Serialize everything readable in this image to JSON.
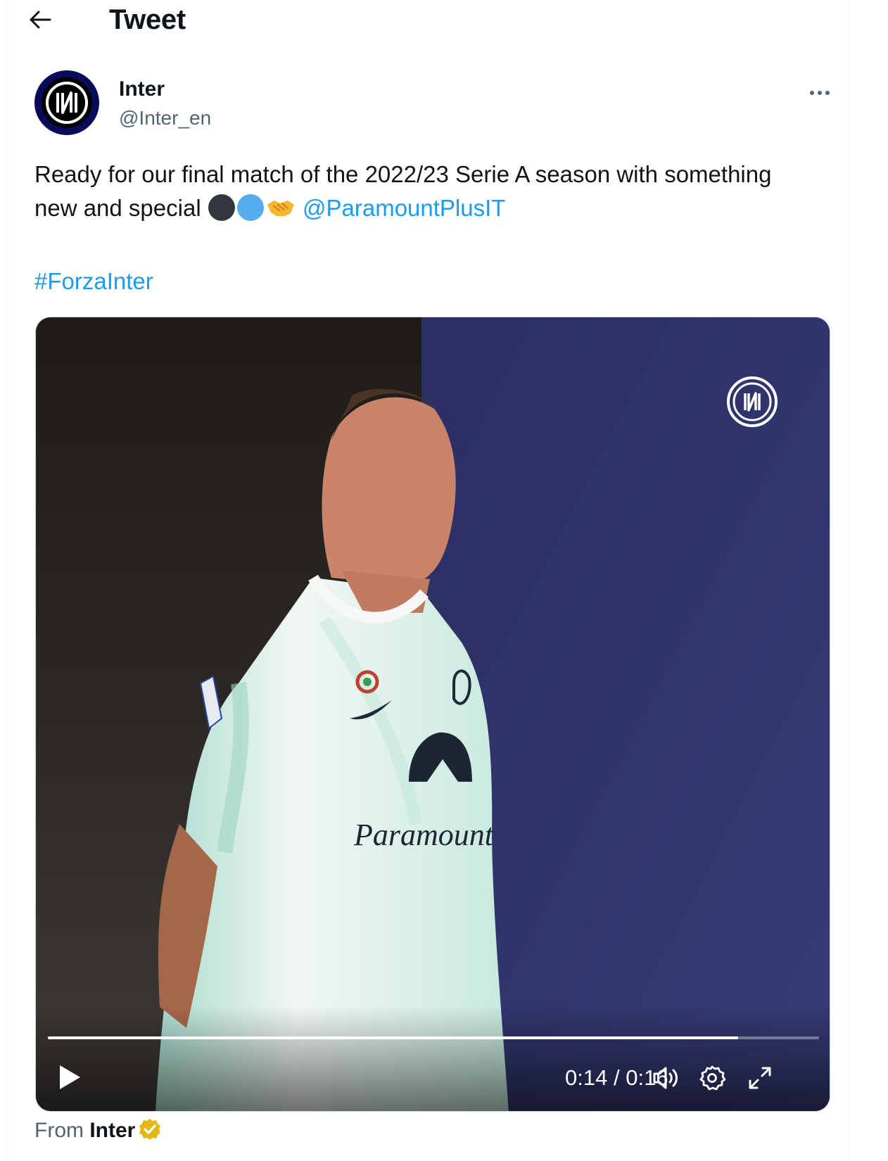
{
  "header": {
    "title": "Tweet",
    "back_icon": "arrow-left-icon"
  },
  "author": {
    "display_name": "Inter",
    "handle": "@Inter_en",
    "avatar_colors": {
      "ring": "#0a0a5a",
      "inner": "#000000",
      "mark": "#ffffff"
    }
  },
  "tweet": {
    "line1": "Ready for our final match of the 2022/23 Serie A season with something",
    "line2_prefix": "new and special",
    "emojis": [
      "black-circle-emoji",
      "blue-circle-emoji",
      "handshake-emoji"
    ],
    "mention": "@ParamountPlusIT",
    "hashtag": "#ForzaInter"
  },
  "video": {
    "current_time": "0:14",
    "time_separator": "/",
    "duration": "0:16",
    "progress_fraction": 0.895,
    "controls": [
      "play-icon",
      "volume-icon",
      "settings-icon",
      "fullscreen-icon"
    ]
  },
  "footer": {
    "from_label": "From",
    "from_name": "Inter",
    "badge": "verified-gold-badge-icon"
  },
  "colors": {
    "link": "#1d9bf0",
    "secondary_text": "#536471",
    "video_bg_right": "#2e3266",
    "video_bg_left": "#2a2520",
    "gold_badge": "#e2b719"
  }
}
